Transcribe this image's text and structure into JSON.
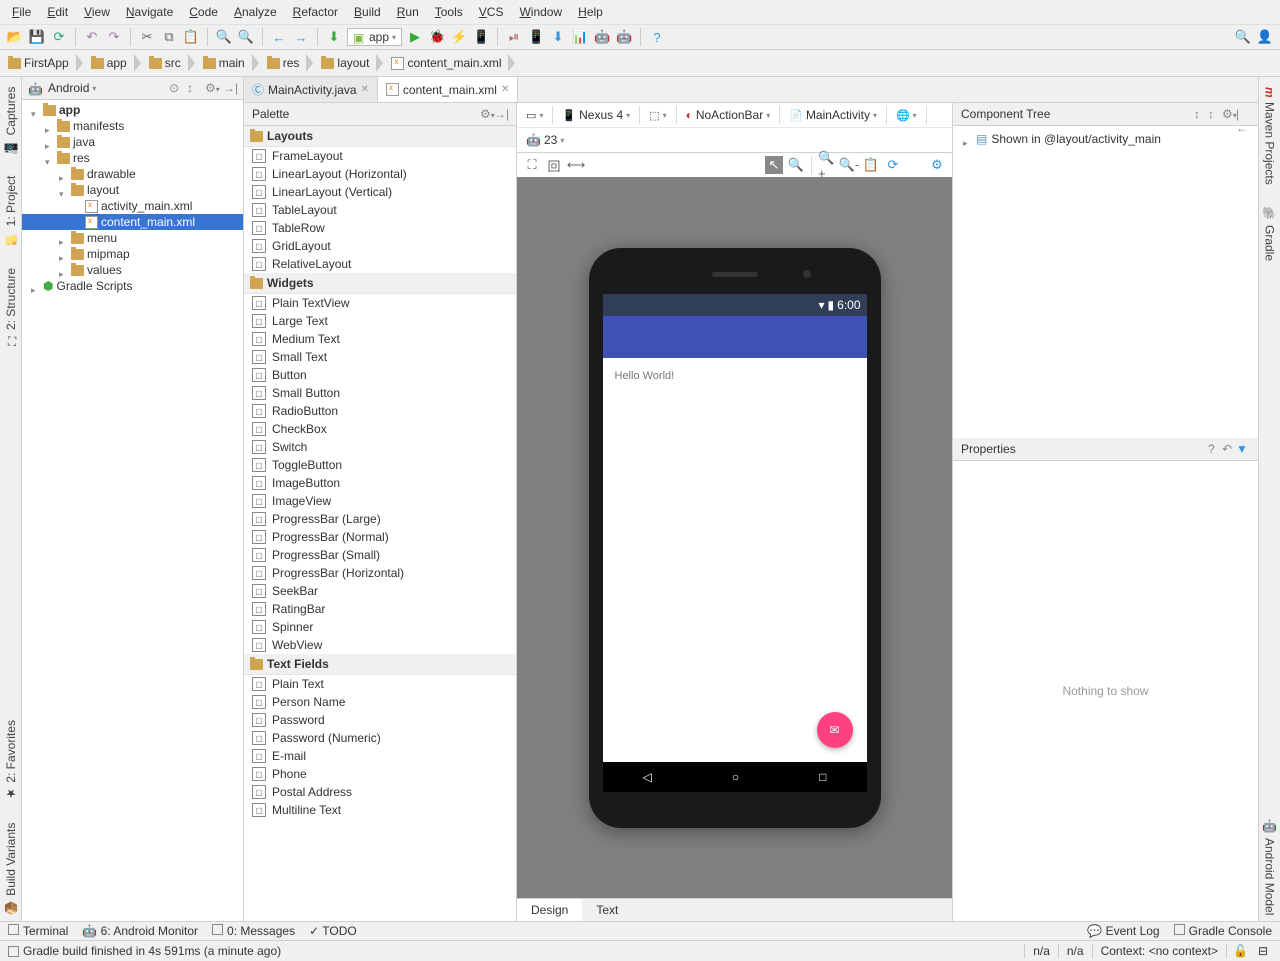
{
  "menu": [
    "File",
    "Edit",
    "View",
    "Navigate",
    "Code",
    "Analyze",
    "Refactor",
    "Build",
    "Run",
    "Tools",
    "VCS",
    "Window",
    "Help"
  ],
  "run_config": "app",
  "breadcrumb": [
    "FirstApp",
    "app",
    "src",
    "main",
    "res",
    "layout",
    "content_main.xml"
  ],
  "project_view_label": "Android",
  "tree": {
    "app": "app",
    "manifests": "manifests",
    "java": "java",
    "res": "res",
    "drawable": "drawable",
    "layout": "layout",
    "activity_main": "activity_main.xml",
    "content_main": "content_main.xml",
    "menu": "menu",
    "mipmap": "mipmap",
    "values": "values",
    "gradle_scripts": "Gradle Scripts"
  },
  "editor_tabs": [
    {
      "label": "MainActivity.java",
      "active": false
    },
    {
      "label": "content_main.xml",
      "active": true
    }
  ],
  "palette": {
    "title": "Palette",
    "groups": [
      {
        "name": "Layouts",
        "items": [
          "FrameLayout",
          "LinearLayout (Horizontal)",
          "LinearLayout (Vertical)",
          "TableLayout",
          "TableRow",
          "GridLayout",
          "RelativeLayout"
        ]
      },
      {
        "name": "Widgets",
        "items": [
          "Plain TextView",
          "Large Text",
          "Medium Text",
          "Small Text",
          "Button",
          "Small Button",
          "RadioButton",
          "CheckBox",
          "Switch",
          "ToggleButton",
          "ImageButton",
          "ImageView",
          "ProgressBar (Large)",
          "ProgressBar (Normal)",
          "ProgressBar (Small)",
          "ProgressBar (Horizontal)",
          "SeekBar",
          "RatingBar",
          "Spinner",
          "WebView"
        ]
      },
      {
        "name": "Text Fields",
        "items": [
          "Plain Text",
          "Person Name",
          "Password",
          "Password (Numeric)",
          "E-mail",
          "Phone",
          "Postal Address",
          "Multiline Text"
        ]
      }
    ]
  },
  "design_toolbar": {
    "device": "Nexus 4",
    "theme": "NoActionBar",
    "activity": "MainActivity",
    "api": "23"
  },
  "preview": {
    "clock": "6:00",
    "hello": "Hello World!"
  },
  "design_tabs": {
    "design": "Design",
    "text": "Text"
  },
  "component_tree": {
    "title": "Component Tree",
    "root": "Shown in @layout/activity_main"
  },
  "properties": {
    "title": "Properties",
    "empty": "Nothing to show"
  },
  "side_left": [
    "Captures",
    "1: Project",
    "2: Structure",
    "2: Favorites",
    "Build Variants"
  ],
  "side_right": [
    "Maven Projects",
    "Gradle",
    "Android Model"
  ],
  "bottom_tabs": [
    "Terminal",
    "6: Android Monitor",
    "0: Messages",
    "TODO"
  ],
  "bottom_right": [
    "Event Log",
    "Gradle Console"
  ],
  "status": {
    "msg": "Gradle build finished in 4s 591ms (a minute ago)",
    "r1": "n/a",
    "r2": "n/a",
    "context": "Context: <no context>"
  }
}
